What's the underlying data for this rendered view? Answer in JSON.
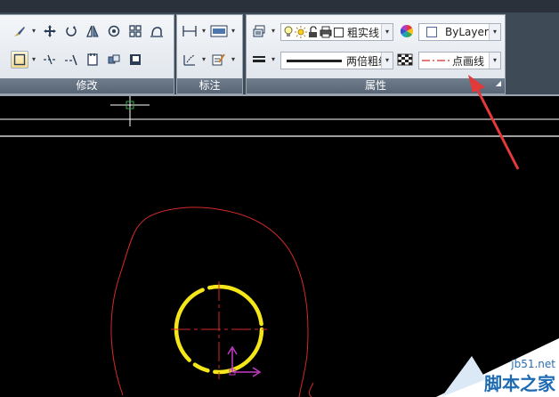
{
  "ribbon": {
    "panels": {
      "modify": {
        "label": "修改"
      },
      "dimension": {
        "label": "标注"
      },
      "properties": {
        "label": "属性"
      }
    },
    "properties": {
      "layer_combo": {
        "value": "粗实线"
      },
      "color_combo": {
        "value": "ByLayer"
      },
      "lineweight_combo": {
        "value": "两倍粗细"
      },
      "linetype_combo": {
        "value": "点画线"
      }
    }
  },
  "watermark": {
    "url": "jb51.net",
    "name": "脚本之家"
  },
  "colors": {
    "ribbon_bg": "#3f4a57",
    "panel_label_bg": "#586575",
    "annotation_arrow": "#e23a3a",
    "outline_red": "#d42a2a",
    "circle_yellow": "#f5e61a",
    "ucs_magenta": "#c43bc4"
  },
  "icons": [
    "brush-icon",
    "move-icon",
    "rotate-icon",
    "mirror-icon",
    "offset-icon",
    "array-icon",
    "stretch-icon",
    "rectangle-icon",
    "trim-icon",
    "extend-icon",
    "copy-icon",
    "explode-icon",
    "fill-icon",
    "linear-dim-icon",
    "table-icon",
    "leader-icon",
    "edit-dim-icon",
    "match-properties-icon",
    "bulb-icon",
    "sun-icon",
    "lock-icon",
    "print-icon",
    "color-wheel-icon",
    "lineweight-icon",
    "transparency-icon"
  ]
}
